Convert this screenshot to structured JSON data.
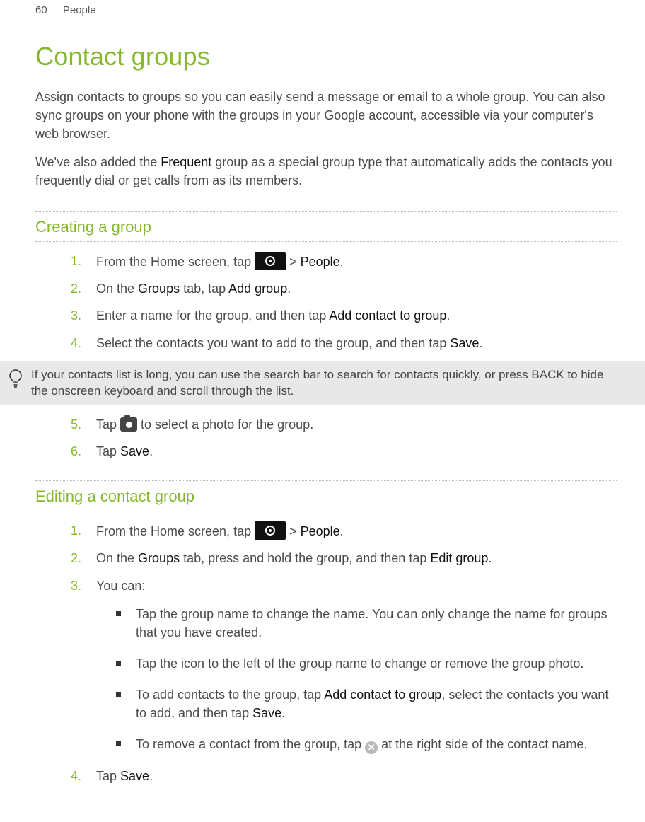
{
  "header": {
    "page_num": "60",
    "section": "People"
  },
  "title": "Contact groups",
  "intro": {
    "p1": "Assign contacts to groups so you can easily send a message or email to a whole group. You can also sync groups on your phone with the groups in your Google account, accessible via your computer's web browser.",
    "p2_a": "We've also added the ",
    "p2_b": "Frequent",
    "p2_c": " group as a special group type that automatically adds the contacts you frequently dial or get calls from as its members."
  },
  "s1": {
    "heading": "Creating a group",
    "steps": {
      "n1": "1.",
      "t1a": "From the Home screen, tap ",
      "t1b": " > ",
      "t1c": "People",
      "t1d": ".",
      "n2": "2.",
      "t2a": "On the ",
      "t2b": "Groups",
      "t2c": " tab, tap ",
      "t2d": "Add group",
      "t2e": ".",
      "n3": "3.",
      "t3a": "Enter a name for the group, and then tap ",
      "t3b": "Add contact to group",
      "t3c": ".",
      "n4": "4.",
      "t4a": "Select the contacts you want to add to the group, and then tap ",
      "t4b": "Save",
      "t4c": ".",
      "n5": "5.",
      "t5a": "Tap ",
      "t5b": " to select a photo for the group.",
      "n6": "6.",
      "t6a": "Tap ",
      "t6b": "Save",
      "t6c": "."
    },
    "tip": "If your contacts list is long, you can use the search bar to search for contacts quickly, or press BACK to hide the onscreen keyboard and scroll through the list."
  },
  "s2": {
    "heading": "Editing a contact group",
    "steps": {
      "n1": "1.",
      "t1a": "From the Home screen, tap ",
      "t1b": " > ",
      "t1c": "People",
      "t1d": ".",
      "n2": "2.",
      "t2a": "On the ",
      "t2b": "Groups",
      "t2c": " tab, press and hold the group, and then tap ",
      "t2d": "Edit group",
      "t2e": ".",
      "n3": "3.",
      "t3": "You can:",
      "b1": "Tap the group name to change the name. You can only change the name for groups that you have created.",
      "b2": "Tap the icon to the left of the group name to change or remove the group photo.",
      "b3a": "To add contacts to the group, tap ",
      "b3b": "Add contact to group",
      "b3c": ", select the contacts you want to add, and then tap ",
      "b3d": "Save",
      "b3e": ".",
      "b4a": "To remove a contact from the group, tap ",
      "b4b": " at the right side of the contact name.",
      "n4": "4.",
      "t4a": "Tap ",
      "t4b": "Save",
      "t4c": "."
    }
  }
}
